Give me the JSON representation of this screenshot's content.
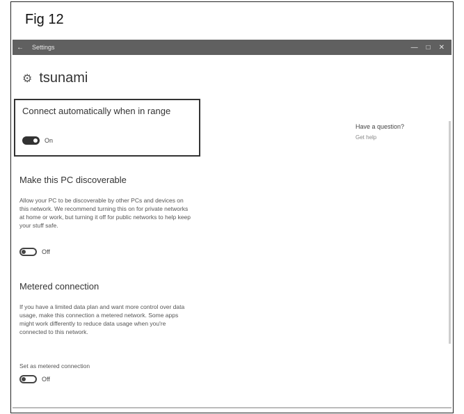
{
  "figure": {
    "label": "Fig 12"
  },
  "window": {
    "title": "Settings",
    "back_glyph": "←",
    "minimize_glyph": "—",
    "maximize_glyph": "□",
    "close_glyph": "✕"
  },
  "page": {
    "title": "tsunami",
    "icon": "gear-icon"
  },
  "auto_connect": {
    "heading": "Connect automatically when in range",
    "toggle_state": "On",
    "is_on": true
  },
  "discoverable": {
    "heading": "Make this PC discoverable",
    "description": "Allow your PC to be discoverable by other PCs and devices on this network. We recommend turning this on for private networks at home or work, but turning it off for public networks to help keep your stuff safe.",
    "toggle_state": "Off",
    "is_on": false
  },
  "metered": {
    "heading": "Metered connection",
    "description": "If you have a limited data plan and want more control over data usage, make this connection a metered network. Some apps might work differently to reduce data usage when you're connected to this network.",
    "set_label": "Set as metered connection",
    "toggle_state": "Off",
    "is_on": false
  },
  "help": {
    "question": "Have a question?",
    "link": "Get help"
  },
  "colors": {
    "titlebar": "#606060",
    "toggle_on": "#333333"
  }
}
